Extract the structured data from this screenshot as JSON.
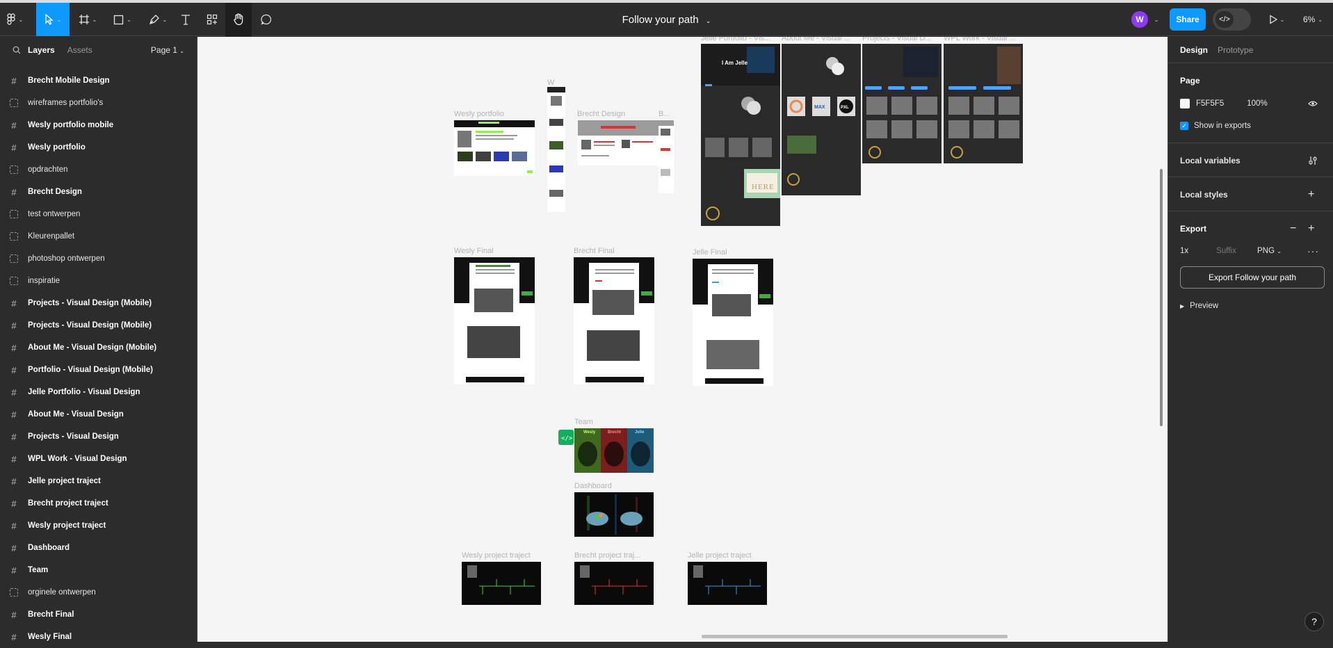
{
  "toolbar": {
    "document_title": "Follow your path",
    "avatar_initial": "W",
    "share_label": "Share",
    "dev_mode_glyph": "</>",
    "zoom": "6%",
    "caret": "⌄"
  },
  "left_panel": {
    "tabs": [
      "Layers",
      "Assets"
    ],
    "page_selector": "Page 1",
    "layers": [
      {
        "name": "Brecht Mobile Design",
        "kind": "frame"
      },
      {
        "name": "wireframes portfolio's",
        "kind": "section"
      },
      {
        "name": "Wesly portfolio mobile",
        "kind": "frame"
      },
      {
        "name": "Wesly portfolio",
        "kind": "frame"
      },
      {
        "name": "opdrachten",
        "kind": "section"
      },
      {
        "name": "Brecht Design",
        "kind": "frame"
      },
      {
        "name": "test ontwerpen",
        "kind": "section"
      },
      {
        "name": "Kleurenpallet",
        "kind": "section"
      },
      {
        "name": "photoshop ontwerpen",
        "kind": "section"
      },
      {
        "name": "inspiratie",
        "kind": "section"
      },
      {
        "name": "Projects - Visual Design (Mobile)",
        "kind": "frame"
      },
      {
        "name": "Projects - Visual Design (Mobile)",
        "kind": "frame"
      },
      {
        "name": "About Me - Visual Design (Mobile)",
        "kind": "frame"
      },
      {
        "name": "Portfolio - Visual Design (Mobile)",
        "kind": "frame"
      },
      {
        "name": "Jelle Portfolio - Visual Design",
        "kind": "frame"
      },
      {
        "name": "About Me - Visual Design",
        "kind": "frame"
      },
      {
        "name": "Projects - Visual Design",
        "kind": "frame"
      },
      {
        "name": "WPL Work - Visual Design",
        "kind": "frame"
      },
      {
        "name": "Jelle project traject",
        "kind": "frame"
      },
      {
        "name": "Brecht project traject",
        "kind": "frame"
      },
      {
        "name": "Wesly project traject",
        "kind": "frame"
      },
      {
        "name": "Dashboard",
        "kind": "frame"
      },
      {
        "name": "Team",
        "kind": "frame"
      },
      {
        "name": "orginele ontwerpen",
        "kind": "section"
      },
      {
        "name": "Brecht Final",
        "kind": "frame"
      },
      {
        "name": "Wesly Final",
        "kind": "frame"
      }
    ]
  },
  "canvas": {
    "background": "#F5F5F5",
    "frame_labels": {
      "wesly_portfolio": "Wesly portfolio",
      "w": "W",
      "brecht_design": "Brecht Design",
      "b": "B...",
      "jelle_portfolio": "Jelle Portfolio - Vis...",
      "about_me": "About Me - Visual ...",
      "projects": "Projects - Visual D...",
      "wpl_work": "WPL Work - Visual ...",
      "wesly_final": "Wesly Final",
      "brecht_final": "Brecht Final",
      "jelle_final": "Jelle Final",
      "team": "Team",
      "dashboard": "Dashboard",
      "wesly_traject": "Wesly project traject",
      "brecht_traject": "Brecht project traj...",
      "jelle_traject": "Jelle project traject"
    },
    "frame_texts": {
      "i_am_jelle": "I Am Jelle",
      "here": "HERE",
      "max": "MAX",
      "pxl": "PXL",
      "team_names": [
        "Wesly",
        "Brecht",
        "Jelle"
      ]
    }
  },
  "right_panel": {
    "tabs": [
      "Design",
      "Prototype"
    ],
    "page_title": "Page",
    "page_color": "F5F5F5",
    "page_opacity": "100%",
    "show_in_exports": "Show in exports",
    "local_variables": "Local variables",
    "local_styles": "Local styles",
    "export_title": "Export",
    "export_scale": "1x",
    "export_suffix_placeholder": "Suffix",
    "export_format": "PNG",
    "export_button": "Export Follow your path",
    "preview": "Preview"
  },
  "colors": {
    "accent": "#0D99FF",
    "avatar": "#8B3BF5",
    "chrome": "#2C2C2C"
  }
}
